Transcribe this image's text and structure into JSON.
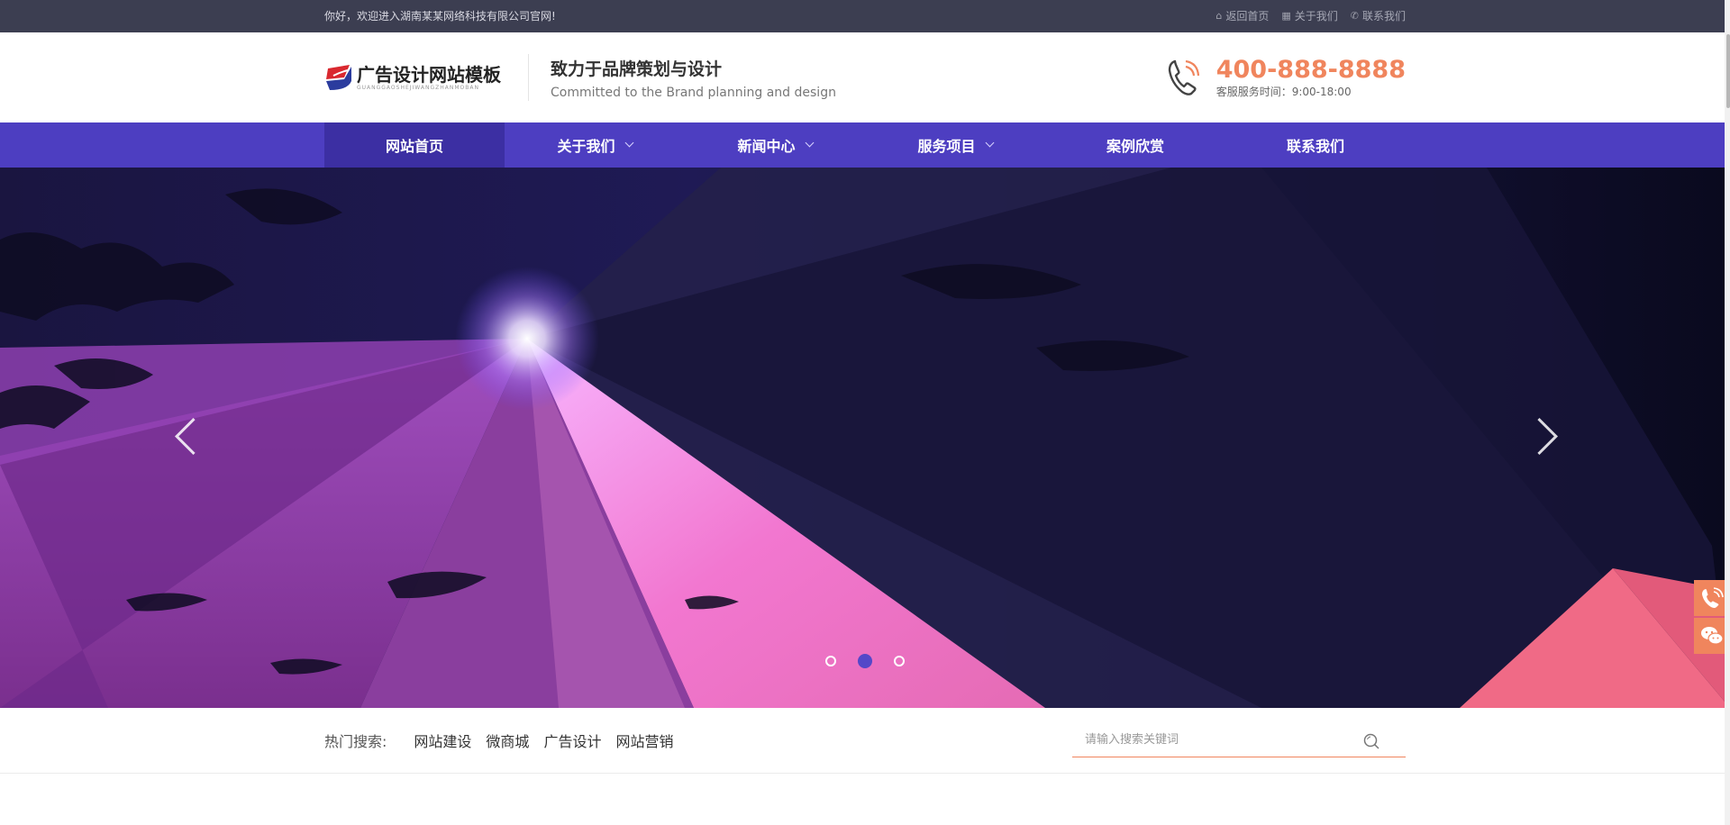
{
  "topbar": {
    "welcome": "你好，欢迎进入湖南某某网络科技有限公司官网!",
    "links": [
      {
        "label": "返回首页",
        "icon": "home-icon"
      },
      {
        "label": "关于我们",
        "icon": "building-icon"
      },
      {
        "label": "联系我们",
        "icon": "phone-icon"
      }
    ]
  },
  "header": {
    "logo_text": "广告设计网站模板",
    "logo_sub": "GUANGGAOSHEJIWANGZHANMOBAN",
    "slogan_cn": "致力于品牌策划与设计",
    "slogan_en": "Committed to the Brand planning and design",
    "phone": "400-888-8888",
    "service_time": "客服服务时间：9:00-18:00"
  },
  "nav": {
    "items": [
      {
        "label": "网站首页",
        "active": true,
        "dropdown": false
      },
      {
        "label": "关于我们",
        "active": false,
        "dropdown": true
      },
      {
        "label": "新闻中心",
        "active": false,
        "dropdown": true
      },
      {
        "label": "服务项目",
        "active": false,
        "dropdown": true
      },
      {
        "label": "案例欣赏",
        "active": false,
        "dropdown": false
      },
      {
        "label": "联系我们",
        "active": false,
        "dropdown": false
      }
    ]
  },
  "banner": {
    "slide_count": 3,
    "active_slide": 2
  },
  "search": {
    "hot_title": "热门搜索:",
    "keywords": [
      "网站建设",
      "微商城",
      "广告设计",
      "网站营销"
    ],
    "placeholder": "请输入搜索关键词"
  },
  "colors": {
    "topbar_bg": "#3c3e51",
    "nav_bg": "#4d3ec1",
    "nav_active_bg": "#3c2fa3",
    "accent": "#f0855d"
  },
  "side_float": [
    "phone-icon",
    "wechat-icon"
  ]
}
